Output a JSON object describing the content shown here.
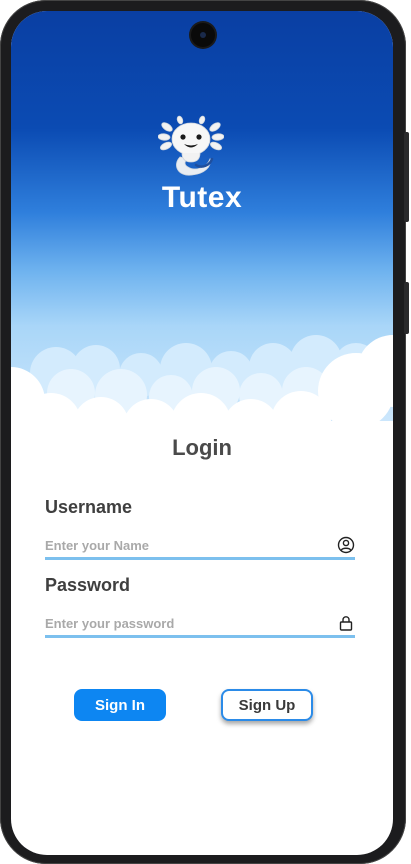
{
  "app": {
    "brand_name": "Tutex",
    "mascot_icon": "axolotl-icon"
  },
  "login": {
    "title": "Login",
    "username_label": "Username",
    "username_placeholder": "Enter your Name",
    "username_icon": "user-circle-icon",
    "password_label": "Password",
    "password_placeholder": "Enter your password",
    "password_icon": "lock-icon",
    "sign_in_label": "Sign In",
    "sign_up_label": "Sign Up"
  },
  "colors": {
    "sky_top": "#0a3fa3",
    "sky_bottom": "#cfe8fc",
    "primary": "#0d86f2",
    "field_underline": "#7cc0ee",
    "text_dark": "#3f3f3f"
  }
}
